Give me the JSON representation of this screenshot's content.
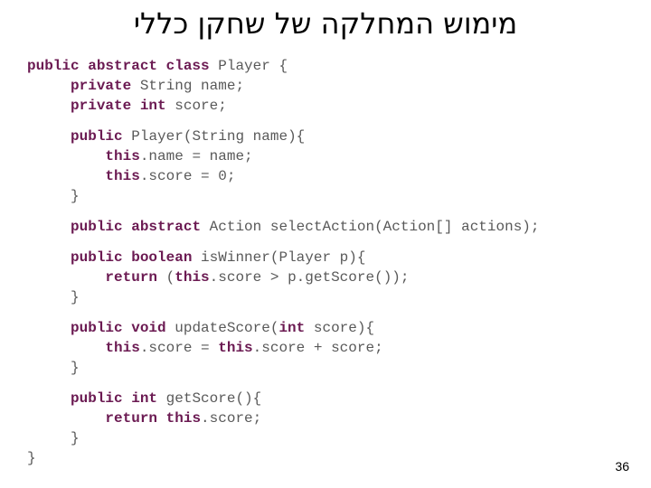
{
  "slide": {
    "title": "מימוש המחלקה של שחקן כללי",
    "page_number": "36",
    "background_color": "#ffffff",
    "keyword_color": "#6b1a52",
    "plain_code_color": "#595959",
    "title_color": "#000000"
  },
  "code": {
    "language": "java",
    "lines": [
      {
        "indent": 0,
        "blank": false,
        "tokens": [
          {
            "t": "public abstract class ",
            "k": true
          },
          {
            "t": "Player {",
            "k": false
          }
        ]
      },
      {
        "indent": 1,
        "blank": false,
        "tokens": [
          {
            "t": "private ",
            "k": true
          },
          {
            "t": "String name;",
            "k": false
          }
        ]
      },
      {
        "indent": 1,
        "blank": false,
        "tokens": [
          {
            "t": "private int ",
            "k": true
          },
          {
            "t": "score;",
            "k": false
          }
        ]
      },
      {
        "indent": 0,
        "blank": true,
        "tokens": []
      },
      {
        "indent": 1,
        "blank": false,
        "tokens": [
          {
            "t": "public ",
            "k": true
          },
          {
            "t": "Player(String name){",
            "k": false
          }
        ]
      },
      {
        "indent": 2,
        "blank": false,
        "tokens": [
          {
            "t": "this",
            "k": true
          },
          {
            "t": ".name = name;",
            "k": false
          }
        ]
      },
      {
        "indent": 2,
        "blank": false,
        "tokens": [
          {
            "t": "this",
            "k": true
          },
          {
            "t": ".score = 0;",
            "k": false
          }
        ]
      },
      {
        "indent": 1,
        "blank": false,
        "tokens": [
          {
            "t": "}",
            "k": false
          }
        ]
      },
      {
        "indent": 0,
        "blank": true,
        "tokens": []
      },
      {
        "indent": 1,
        "blank": false,
        "tokens": [
          {
            "t": "public abstract ",
            "k": true
          },
          {
            "t": "Action selectAction(Action[] actions);",
            "k": false
          }
        ]
      },
      {
        "indent": 0,
        "blank": true,
        "tokens": []
      },
      {
        "indent": 1,
        "blank": false,
        "tokens": [
          {
            "t": "public boolean ",
            "k": true
          },
          {
            "t": "isWinner(Player p){",
            "k": false
          }
        ]
      },
      {
        "indent": 2,
        "blank": false,
        "tokens": [
          {
            "t": "return ",
            "k": true
          },
          {
            "t": "(",
            "k": false
          },
          {
            "t": "this",
            "k": true
          },
          {
            "t": ".score > p.getScore());",
            "k": false
          }
        ]
      },
      {
        "indent": 1,
        "blank": false,
        "tokens": [
          {
            "t": "}",
            "k": false
          }
        ]
      },
      {
        "indent": 0,
        "blank": true,
        "tokens": []
      },
      {
        "indent": 1,
        "blank": false,
        "tokens": [
          {
            "t": "public void ",
            "k": true
          },
          {
            "t": "updateScore(",
            "k": false
          },
          {
            "t": "int ",
            "k": true
          },
          {
            "t": "score){",
            "k": false
          }
        ]
      },
      {
        "indent": 2,
        "blank": false,
        "tokens": [
          {
            "t": "this",
            "k": true
          },
          {
            "t": ".score = ",
            "k": false
          },
          {
            "t": "this",
            "k": true
          },
          {
            "t": ".score + score;",
            "k": false
          }
        ]
      },
      {
        "indent": 1,
        "blank": false,
        "tokens": [
          {
            "t": "}",
            "k": false
          }
        ]
      },
      {
        "indent": 0,
        "blank": true,
        "tokens": []
      },
      {
        "indent": 1,
        "blank": false,
        "tokens": [
          {
            "t": "public int ",
            "k": true
          },
          {
            "t": "getScore(){",
            "k": false
          }
        ]
      },
      {
        "indent": 2,
        "blank": false,
        "tokens": [
          {
            "t": "return this",
            "k": true
          },
          {
            "t": ".score;",
            "k": false
          }
        ]
      },
      {
        "indent": 1,
        "blank": false,
        "tokens": [
          {
            "t": "}",
            "k": false
          }
        ]
      },
      {
        "indent": 0,
        "blank": false,
        "tokens": [
          {
            "t": "}",
            "k": false
          }
        ]
      }
    ]
  }
}
